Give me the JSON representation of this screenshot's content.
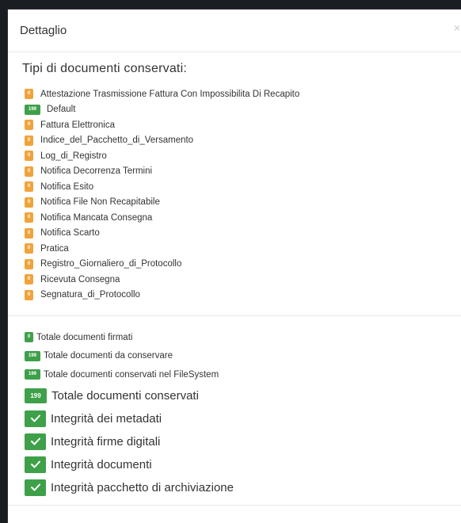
{
  "modal": {
    "title": "Dettaglio",
    "close_label": "×"
  },
  "section_title": "Tipi di documenti conservati:",
  "document_types": [
    {
      "label": "Attestazione Trasmissione Fattura Con Impossibilita Di Recapito",
      "count": "0",
      "color": "orange"
    },
    {
      "label": "Default",
      "count": "199",
      "color": "green"
    },
    {
      "label": "Fattura Elettronica",
      "count": "0",
      "color": "orange"
    },
    {
      "label": "Indice_del_Pacchetto_di_Versamento",
      "count": "0",
      "color": "orange"
    },
    {
      "label": "Log_di_Registro",
      "count": "0",
      "color": "orange"
    },
    {
      "label": "Notifica Decorrenza Termini",
      "count": "0",
      "color": "orange"
    },
    {
      "label": "Notifica Esito",
      "count": "0",
      "color": "orange"
    },
    {
      "label": "Notifica File Non Recapitabile",
      "count": "0",
      "color": "orange"
    },
    {
      "label": "Notifica Mancata Consegna",
      "count": "0",
      "color": "orange"
    },
    {
      "label": "Notifica Scarto",
      "count": "0",
      "color": "orange"
    },
    {
      "label": "Pratica",
      "count": "0",
      "color": "orange"
    },
    {
      "label": "Registro_Giornaliero_di_Protocollo",
      "count": "0",
      "color": "orange"
    },
    {
      "label": "Ricevuta Consegna",
      "count": "0",
      "color": "orange"
    },
    {
      "label": "Segnatura_di_Protocollo",
      "count": "0",
      "color": "orange"
    }
  ],
  "totals": {
    "firmati": {
      "label": "Totale documenti firmati",
      "count": "0"
    },
    "da_conservare": {
      "label": "Totale documenti da conservare",
      "count": "199"
    },
    "filesystem": {
      "label": "Totale documenti conservati nel FileSystem",
      "count": "199"
    },
    "conservati": {
      "label": "Totale documenti conservati",
      "count": "199"
    }
  },
  "checks": [
    {
      "label": "Integrità dei metadati",
      "icon": "check-icon"
    },
    {
      "label": "Integrità firme digitali",
      "icon": "check-icon"
    },
    {
      "label": "Integrità documenti",
      "icon": "check-icon"
    },
    {
      "label": "Integrità pacchetto di archiviazione",
      "icon": "check-icon"
    }
  ],
  "colors": {
    "orange": "#f0a33a",
    "green": "#3fa04a"
  }
}
